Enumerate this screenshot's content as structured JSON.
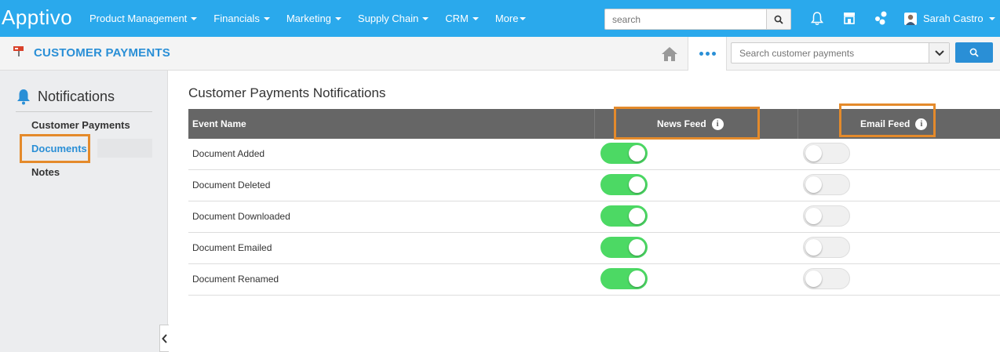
{
  "app": {
    "logo": "Apptivo"
  },
  "nav": {
    "items": [
      {
        "label": "Product Management",
        "has_caret": true
      },
      {
        "label": "Financials",
        "has_caret": true
      },
      {
        "label": "Marketing",
        "has_caret": true
      },
      {
        "label": "Supply Chain",
        "has_caret": true
      },
      {
        "label": "CRM",
        "has_caret": true
      },
      {
        "label": "More",
        "has_caret": true
      }
    ],
    "search_placeholder": "search",
    "user_name": "Sarah Castro",
    "icons": [
      "bell-icon",
      "store-icon",
      "apps-icon"
    ]
  },
  "subheader": {
    "title": "CUSTOMER PAYMENTS",
    "search_placeholder": "Search customer payments"
  },
  "sidebar": {
    "heading": "Notifications",
    "items": [
      {
        "label": "Customer Payments",
        "active": false
      },
      {
        "label": "Documents",
        "active": true
      },
      {
        "label": "Notes",
        "active": false
      }
    ]
  },
  "main": {
    "title": "Customer Payments Notifications",
    "columns": {
      "event": "Event Name",
      "news": "News Feed",
      "email": "Email Feed"
    },
    "rows": [
      {
        "name": "Document Added",
        "news_feed": true,
        "email_feed": false
      },
      {
        "name": "Document Deleted",
        "news_feed": true,
        "email_feed": false
      },
      {
        "name": "Document Downloaded",
        "news_feed": true,
        "email_feed": false
      },
      {
        "name": "Document Emailed",
        "news_feed": true,
        "email_feed": false
      },
      {
        "name": "Document Renamed",
        "news_feed": true,
        "email_feed": false
      }
    ]
  },
  "colors": {
    "nav_bg": "#2aa9ec",
    "accent": "#2a8fd6",
    "highlight": "#e48a2b",
    "toggle_on": "#4cd964",
    "header_bg": "#666666"
  }
}
